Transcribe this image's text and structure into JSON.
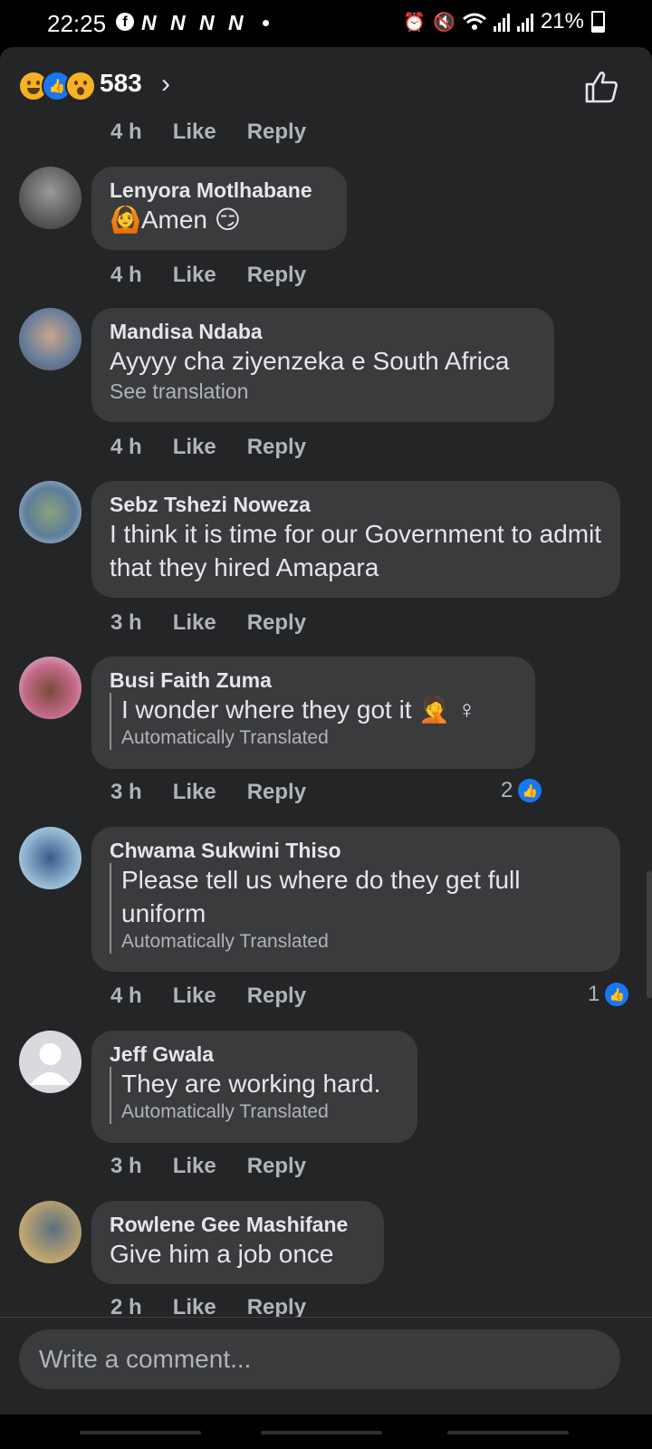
{
  "status_bar": {
    "time": "22:25",
    "fb_glyph": "f",
    "notif_n": [
      "N",
      "N",
      "N",
      "N"
    ],
    "battery": "21%",
    "icons": [
      "alarm-icon",
      "mute-icon",
      "wifi-icon",
      "signal-icon",
      "signal-icon",
      "battery-icon"
    ]
  },
  "reactions": {
    "count": "583",
    "types": [
      "haha",
      "like",
      "wow"
    ]
  },
  "meta_labels": {
    "like": "Like",
    "reply": "Reply"
  },
  "top_meta": {
    "time": "4 h"
  },
  "comments": [
    {
      "name": "Lenyora Motlhabane",
      "text": "🙆Amen 😏",
      "time": "4 h"
    },
    {
      "name": "Mandisa Ndaba",
      "text": "Ayyyy cha ziyenzeka e South Africa",
      "sub": "See translation",
      "time": "4 h"
    },
    {
      "name": "Sebz Tshezi Noweza",
      "text": "I think it is time for our Government to admit that they hired Amapara",
      "time": "3 h"
    },
    {
      "name": "Busi Faith Zuma",
      "text": "I wonder where they got it 🤦 ♀",
      "sub": "Automatically Translated",
      "time": "3 h",
      "likes": "2"
    },
    {
      "name": "Chwama Sukwini Thiso",
      "text": "Please tell us where do they get full uniform",
      "sub": "Automatically Translated",
      "time": "4 h",
      "likes": "1"
    },
    {
      "name": "Jeff Gwala",
      "text": "They are working hard.",
      "sub": "Automatically Translated",
      "time": "3 h"
    },
    {
      "name": "Rowlene Gee Mashifane",
      "text": "Give him a job once",
      "time": "2 h"
    }
  ],
  "composer": {
    "placeholder": "Write a comment..."
  },
  "colors": {
    "background": "#242526",
    "bubble": "#3a3b3c",
    "accent": "#1877f2",
    "muted": "#b0b3b8"
  }
}
